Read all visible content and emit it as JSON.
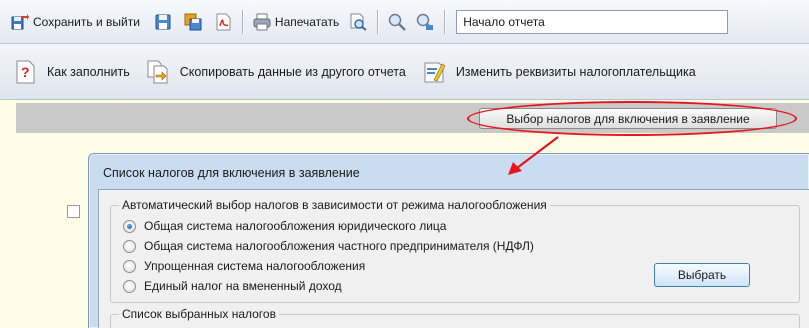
{
  "toolbar1": {
    "save_exit_label": "Сохранить и выйти",
    "print_label": "Напечатать",
    "section_combo_value": "Начало отчета",
    "icons": [
      "save-exit-icon",
      "floppy-icon",
      "save-copy-icon",
      "pdf-icon",
      "print-icon",
      "print-preview-icon",
      "zoom-icon",
      "zoom-settings-icon"
    ]
  },
  "toolbar2": {
    "how_to_fill_label": "Как заполнить",
    "copy_data_label": "Скопировать данные из другого отчета",
    "change_details_label": "Изменить реквизиты налогоплательщика"
  },
  "page": {
    "choose_taxes_button": "Выбор налогов для включения в заявление"
  },
  "dialog": {
    "title": "Список налогов для включения в заявление",
    "auto_group_caption": "Автоматический выбор налогов в зависимости от режима налогообложения",
    "options": [
      {
        "label": "Общая система налогообложения юридического лица",
        "selected": true
      },
      {
        "label": "Общая система налогообложения частного предпринимателя (НДФЛ)",
        "selected": false
      },
      {
        "label": "Упрощенная система налогообложения",
        "selected": false
      },
      {
        "label": "Единый налог на вмененный доход",
        "selected": false
      }
    ],
    "select_button": "Выбрать",
    "selected_group_caption": "Список выбранных налогов"
  },
  "colors": {
    "highlight": "#e8141b",
    "page_background": "#fffde6"
  }
}
